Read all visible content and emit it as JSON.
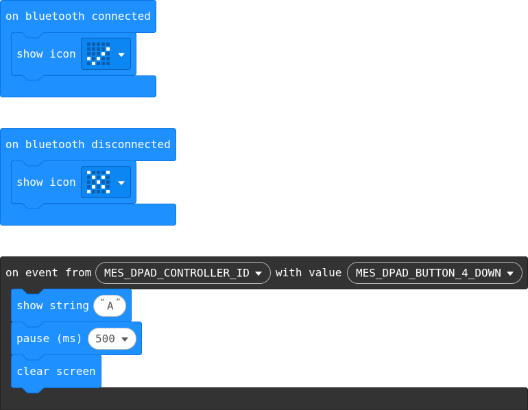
{
  "blocks": {
    "bt_connected": {
      "hat_label": "on bluetooth connected",
      "show_icon_label": "show icon",
      "icon_leds": [
        [
          0,
          0,
          0,
          0,
          0
        ],
        [
          0,
          0,
          0,
          0,
          1
        ],
        [
          0,
          0,
          0,
          1,
          0
        ],
        [
          1,
          0,
          1,
          0,
          0
        ],
        [
          0,
          1,
          0,
          0,
          0
        ]
      ]
    },
    "bt_disconnected": {
      "hat_label": "on bluetooth disconnected",
      "show_icon_label": "show icon",
      "icon_leds": [
        [
          1,
          0,
          0,
          0,
          1
        ],
        [
          0,
          1,
          0,
          1,
          0
        ],
        [
          0,
          0,
          1,
          0,
          0
        ],
        [
          0,
          1,
          0,
          1,
          0
        ],
        [
          1,
          0,
          0,
          0,
          1
        ]
      ]
    },
    "event": {
      "prefix": "on event from",
      "source_value": "MES_DPAD_CONTROLLER_ID",
      "middle": "with value",
      "value_value": "MES_DPAD_BUTTON_4_DOWN",
      "show_string_label": "show string",
      "string_value": "A",
      "pause_label": "pause (ms)",
      "pause_value": "500",
      "clear_label": "clear screen"
    }
  },
  "colors": {
    "basic_block": "#1e90ff",
    "basic_block_border": "#0b75e0",
    "control_block": "#333333",
    "white": "#ffffff"
  },
  "icons": {
    "dropdown": "caret-down",
    "quote_open": "left-double-quote",
    "quote_close": "right-double-quote"
  }
}
